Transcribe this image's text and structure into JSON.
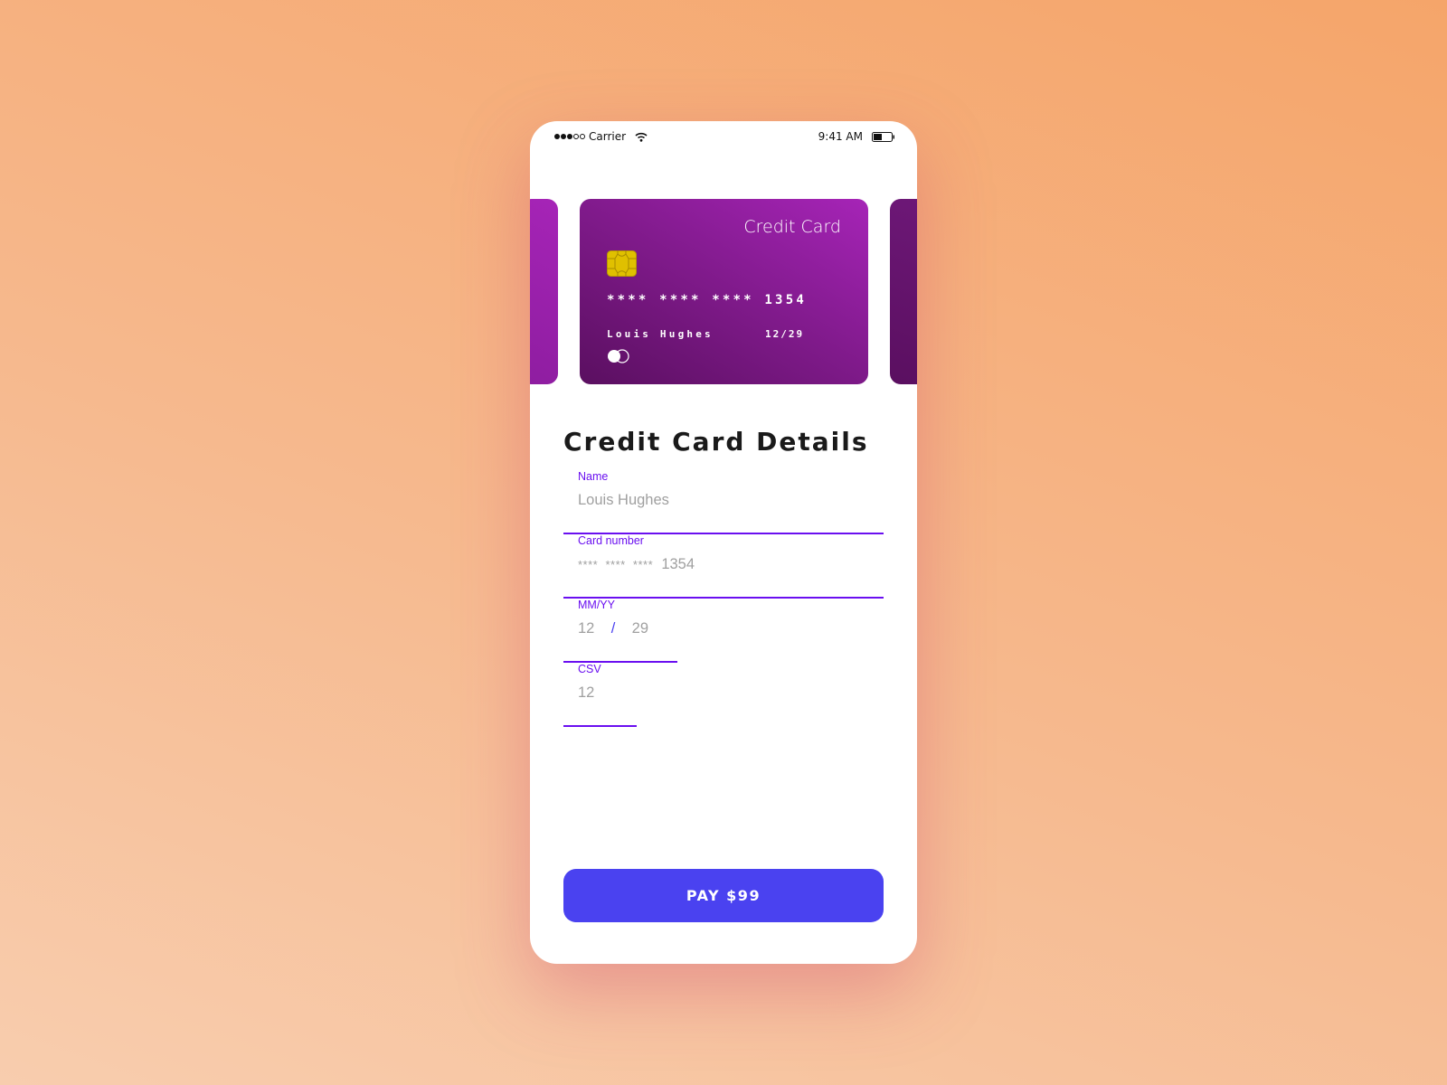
{
  "status_bar": {
    "carrier": "Carrier",
    "time": "9:41 AM",
    "signal_bars": 3,
    "signal_total": 5,
    "battery_percent": 40,
    "icons": [
      "signal-dots-icon",
      "wifi-icon",
      "battery-icon"
    ]
  },
  "card": {
    "title": "Credit Card",
    "number": "**** **** **** 1354",
    "holder": "Louis Hughes",
    "expiry": "12/29",
    "icons": [
      "chip-icon",
      "card-logo-icon"
    ],
    "gradient": [
      "#5a0f60",
      "#a624b7"
    ]
  },
  "form": {
    "title": "Credit Card Details",
    "name": {
      "label": "Name",
      "value": "Louis Hughes"
    },
    "card_number": {
      "label": "Card number",
      "masked": "****  ****  ****",
      "last4": "1354"
    },
    "expiry": {
      "label": "MM/YY",
      "month": "12",
      "separator": "/",
      "year": "29"
    },
    "csv": {
      "label": "CSV",
      "value": "12"
    }
  },
  "pay_button": {
    "label": "PAY $99"
  },
  "colors": {
    "accent": "#6a0ff0",
    "button": "#4a42f0",
    "chip": "#e0c000"
  }
}
